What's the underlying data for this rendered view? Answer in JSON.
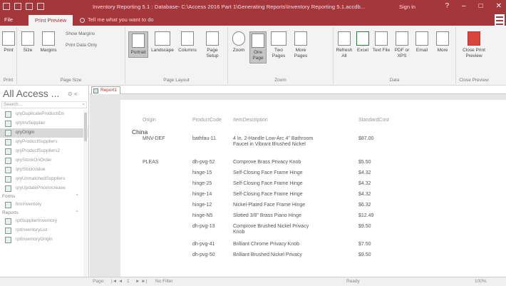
{
  "window": {
    "title": "Inventory Reporting 5.1 : Database- C:\\Access 2016 Part 1\\Generating Reports\\Inventory Reporting 5.1.accdb...",
    "signin": "Sign in",
    "controls": [
      "?",
      "–",
      "□",
      "✕"
    ]
  },
  "ribbon_tabs": {
    "file": "File",
    "print_preview": "Print Preview",
    "tell_me": "Tell me what you want to do"
  },
  "ribbon": {
    "groups": {
      "print": "Print",
      "page_size": "Page Size",
      "page_layout": "Page Layout",
      "zoom": "Zoom",
      "data": "Data",
      "close_preview": "Close Preview"
    },
    "buttons": {
      "print": "Print",
      "size": "Size",
      "margins": "Margins",
      "show_margins": "Show Margins",
      "print_data_only": "Print Data Only",
      "portrait": "Portrait",
      "landscape": "Landscape",
      "columns": "Columns",
      "page_setup": "Page Setup",
      "zoom": "Zoom",
      "one_page": "One Page",
      "two_pages": "Two Pages",
      "more_pages": "More Pages",
      "refresh_all": "Refresh All",
      "excel": "Excel",
      "text_file": "Text File",
      "pdf_or_xps": "PDF or XPS",
      "email": "Email",
      "more": "More",
      "close_print_preview": "Close Print Preview"
    }
  },
  "nav": {
    "title": "All Access ...",
    "search_placeholder": "Search...",
    "items": [
      {
        "label": "qryDuplicateProductIDs"
      },
      {
        "label": "qryInvSupplier"
      },
      {
        "label": "qryOrigin",
        "selected": true
      },
      {
        "label": "qryProductSuppliers"
      },
      {
        "label": "qryProductSuppliers2"
      },
      {
        "label": "qryStockOnOrder"
      },
      {
        "label": "qryStockValue"
      },
      {
        "label": "qryUnmatchedSuppliers"
      },
      {
        "label": "qryUpdatePriceIncrease"
      }
    ],
    "sections": {
      "forms": "Forms",
      "reports": "Reports"
    },
    "forms": [
      {
        "label": "frmInventory"
      }
    ],
    "reports": [
      {
        "label": "rptSupplierInventory"
      },
      {
        "label": "rptInventoryList"
      },
      {
        "label": "rptInventoryOrigin"
      }
    ]
  },
  "doc_tab": {
    "label": "Report1"
  },
  "report": {
    "headers": {
      "origin": "Origin",
      "product_code": "ProductCode",
      "description": "ItemDescription",
      "unit_cost": "StandardCost"
    },
    "origin_value": "China",
    "rows": [
      {
        "supplier": "MNV-DEF",
        "code": "bathfau-11",
        "desc": "4 In. 2-Handle Low-Arc 4\" Bathroom Faucet in Vibrant Brushed Nickel",
        "cost": "$87.00"
      },
      {
        "supplier": "PLEAS",
        "code": "dh-pvg-52",
        "desc": "Comprove Brass Privacy Knob",
        "cost": "$5.50"
      },
      {
        "supplier": "",
        "code": "hinge-15",
        "desc": "Self-Closing Face Frame Hinge",
        "cost": "$4.32"
      },
      {
        "supplier": "",
        "code": "hinge-25",
        "desc": "Self-Closing Face Frame Hinge",
        "cost": "$4.32"
      },
      {
        "supplier": "",
        "code": "hinge-14",
        "desc": "Self-Closing Face Frame Hinge",
        "cost": "$4.32"
      },
      {
        "supplier": "",
        "code": "hinge-12",
        "desc": "Nickel-Plated Face Frame Hinge",
        "cost": "$6.32"
      },
      {
        "supplier": "",
        "code": "hinge-N5",
        "desc": "Slotted 3/8\" Brass Piano Hinge",
        "cost": "$12.49"
      },
      {
        "supplier": "",
        "code": "dh-pvg-13",
        "desc": "Comprove Brushed Nickel Privacy Knob",
        "cost": "$9.50"
      },
      {
        "supplier": "",
        "code": "dh-pvg-41",
        "desc": "Brilliant Chrome Privacy Knob",
        "cost": "$7.50"
      },
      {
        "supplier": "",
        "code": "dh-pvg-50",
        "desc": "Brilliant Brushed Nickel Privacy",
        "cost": "$9.50"
      }
    ]
  },
  "status": {
    "page_label": "Page:",
    "page_value": "1",
    "filter": "No Filter",
    "ready": "Ready",
    "zoom": "100%"
  },
  "colors": {
    "accent": "#a4373a",
    "ribbon_bg": "#f3f3f3",
    "preview_bg": "#e6e6e6"
  }
}
